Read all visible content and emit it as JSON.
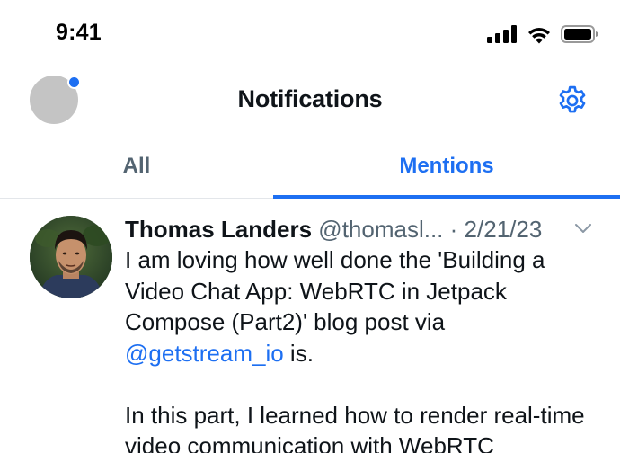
{
  "status_bar": {
    "time": "9:41"
  },
  "header": {
    "title": "Notifications",
    "accent_color": "#1d6ff2"
  },
  "tabs": [
    {
      "label": "All",
      "active": false
    },
    {
      "label": "Mentions",
      "active": true
    }
  ],
  "tweet": {
    "author_name": "Thomas Landers",
    "author_handle": "@thomasl...",
    "separator": "·",
    "date": "2/21/23",
    "body_line_1": "I am loving how well done the 'Building a Video Chat App: WebRTC in Jetpack Compose (Part2)' blog post via",
    "mention": "@getstream_io",
    "body_line_1_end": " is.",
    "body_paragraph_2": "In this part, I learned how to render real-time video communication with WebRTC"
  },
  "icons": {
    "signal": "cellular-signal-icon",
    "wifi": "wifi-icon",
    "battery": "battery-icon",
    "settings": "gear-icon",
    "more": "chevron-down-icon"
  }
}
